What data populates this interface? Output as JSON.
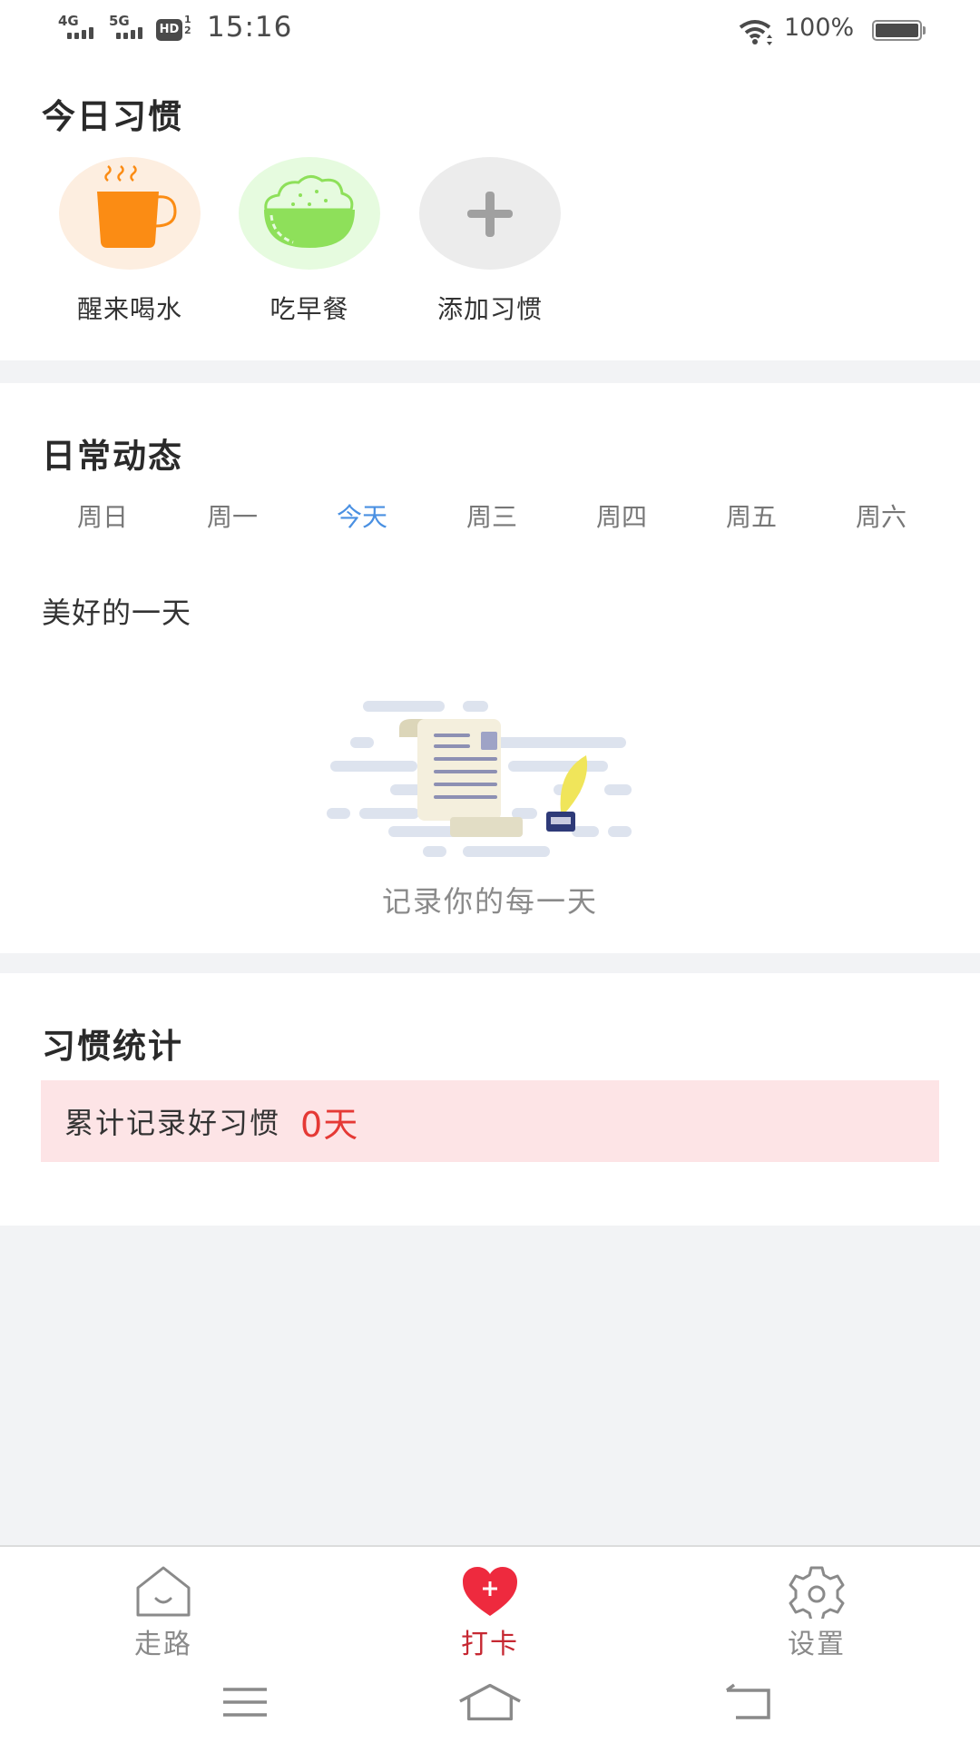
{
  "status_bar": {
    "network1": "4G",
    "network2": "5G",
    "hd_label": "HD",
    "hd_sub": "1\n2",
    "time": "15:16",
    "battery_pct": "100%",
    "battery_level": 1.0
  },
  "today_habits": {
    "title": "今日习惯",
    "items": [
      {
        "label": "醒来喝水",
        "icon": "coffee-cup-icon",
        "bg": "#fdeee0",
        "color": "#fb8c14"
      },
      {
        "label": "吃早餐",
        "icon": "rice-bowl-icon",
        "bg": "#e6fbdf",
        "color": "#8ee05a"
      },
      {
        "label": "添加习惯",
        "icon": "plus-icon",
        "bg": "#ececec",
        "color": "#a0a0a0"
      }
    ]
  },
  "daily": {
    "title": "日常动态",
    "weekdays": [
      "周日",
      "周一",
      "今天",
      "周三",
      "周四",
      "周五",
      "周六"
    ],
    "active_index": 2,
    "subtitle": "美好的一天",
    "empty_caption": "记录你的每一天",
    "empty_icon": "scroll-quill-illustration"
  },
  "stats": {
    "title": "习惯统计",
    "label": "累计记录好习惯",
    "value": "0天"
  },
  "tabbar": {
    "items": [
      {
        "label": "走路",
        "icon": "house-icon",
        "active": false
      },
      {
        "label": "打卡",
        "icon": "heart-plus-icon",
        "active": true
      },
      {
        "label": "设置",
        "icon": "gear-icon",
        "active": false
      }
    ]
  },
  "colors": {
    "accent_blue": "#4a90e2",
    "accent_red": "#e53935",
    "tab_active": "#c62832",
    "stats_bg": "#fde4e6",
    "page_bg": "#f2f3f5"
  }
}
